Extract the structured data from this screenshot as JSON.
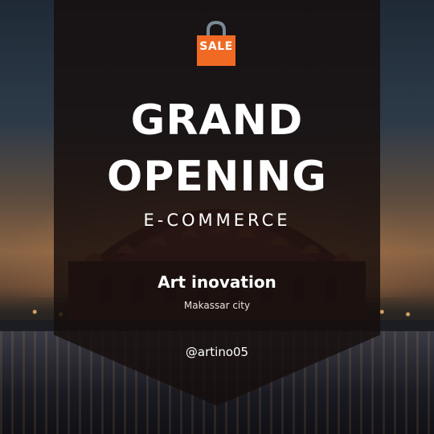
{
  "poster": {
    "sale_badge": "SALE",
    "title_line1": "GRAND",
    "title_line2": "OPENING",
    "subtitle": "E-COMMERCE",
    "brand": "Art inovation",
    "city": "Makassar city",
    "handle": "@artino05"
  },
  "colors": {
    "panel": "#160e0c",
    "bag": "#f06a24",
    "bag_handle": "#7a8a94",
    "text": "#ffffff"
  },
  "icons": {
    "bag": "shopping-bag-icon"
  }
}
